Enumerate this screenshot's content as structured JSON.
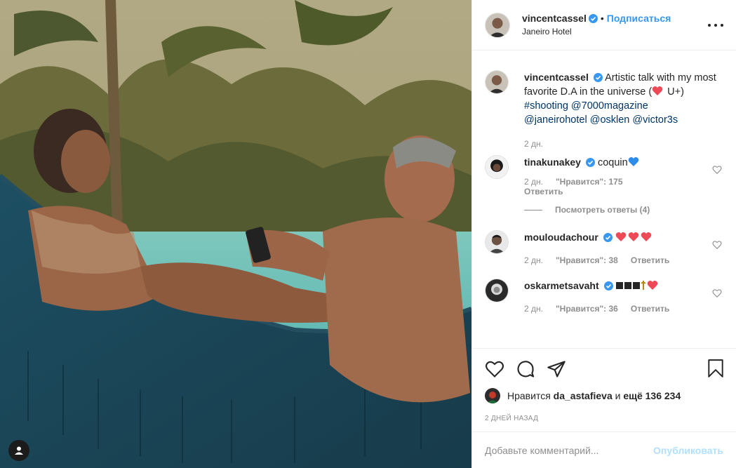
{
  "post": {
    "author": "vincentcassel",
    "follow_label": "Подписаться",
    "separator": "•",
    "location": "Janeiro Hotel"
  },
  "caption": {
    "author": "vincentcassel",
    "text": "Artistic talk with my most favorite D.A in the universe (",
    "text_end": " U+)",
    "tags": [
      "#shooting",
      "@7000magazine",
      "@janeirohotel",
      "@osklen",
      "@victor3s"
    ],
    "age": "2 дн."
  },
  "comments": [
    {
      "author": "tinakunakey",
      "text": "coquin",
      "age": "2 дн.",
      "likes": "\"Нравится\": 175",
      "reply": "Ответить",
      "view_replies": "Посмотреть ответы (4)"
    },
    {
      "author": "mouloudachour",
      "text": "",
      "age": "2 дн.",
      "likes": "\"Нравится\": 38",
      "reply": "Ответить"
    },
    {
      "author": "oskarmetsavaht",
      "text": "",
      "age": "2 дн.",
      "likes": "\"Нравится\": 36",
      "reply": "Ответить"
    }
  ],
  "likes_summary": {
    "prefix": "Нравится",
    "user": "da_astafieva",
    "and": "и",
    "count": "ещё 136 234"
  },
  "posted": "2 дней назад",
  "add_comment": {
    "placeholder": "Добавьте комментарий...",
    "publish_label": "Опубликовать"
  },
  "colors": {
    "accent": "#3897f0",
    "heart": "#ed4956",
    "verified": "#3897f0",
    "muted": "#8e8e8e"
  },
  "icons": [
    "verified-icon",
    "more-icon",
    "heart-icon",
    "comment-icon",
    "share-icon",
    "bookmark-icon",
    "user-tag-icon"
  ]
}
